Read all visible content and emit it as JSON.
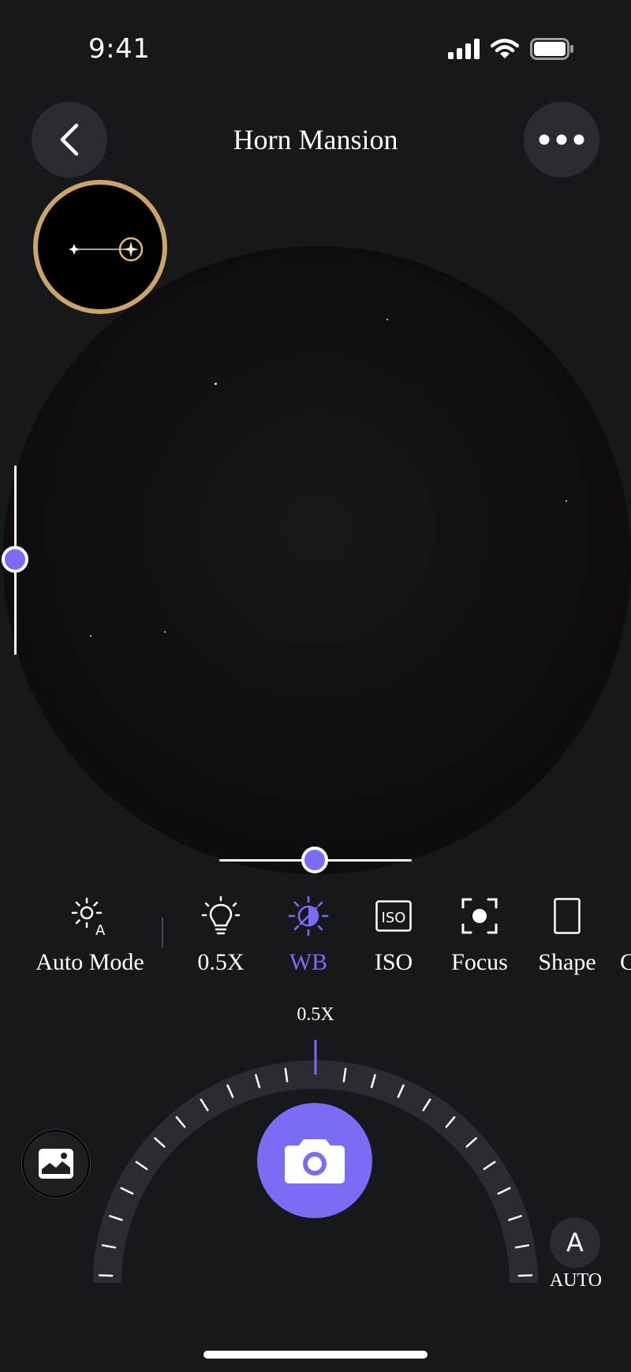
{
  "status_bar": {
    "time": "9:41"
  },
  "header": {
    "title": "Horn Mansion"
  },
  "toolbar": {
    "items": [
      {
        "label": "Auto Mode",
        "icon": "auto-brightness-icon"
      },
      {
        "label": "0.5X",
        "icon": "bulb-icon"
      },
      {
        "label": "WB",
        "icon": "white-balance-icon",
        "active": true
      },
      {
        "label": "ISO",
        "icon": "iso-icon"
      },
      {
        "label": "Focus",
        "icon": "focus-icon"
      },
      {
        "label": "Shape",
        "icon": "shape-icon"
      },
      {
        "label": "C",
        "icon": ""
      }
    ]
  },
  "dial": {
    "value": "0.5X"
  },
  "auto": {
    "letter": "A",
    "label": "AUTO"
  },
  "colors": {
    "accent": "#7b6cf6",
    "background": "#17181c",
    "ring": "#c9a56a"
  }
}
